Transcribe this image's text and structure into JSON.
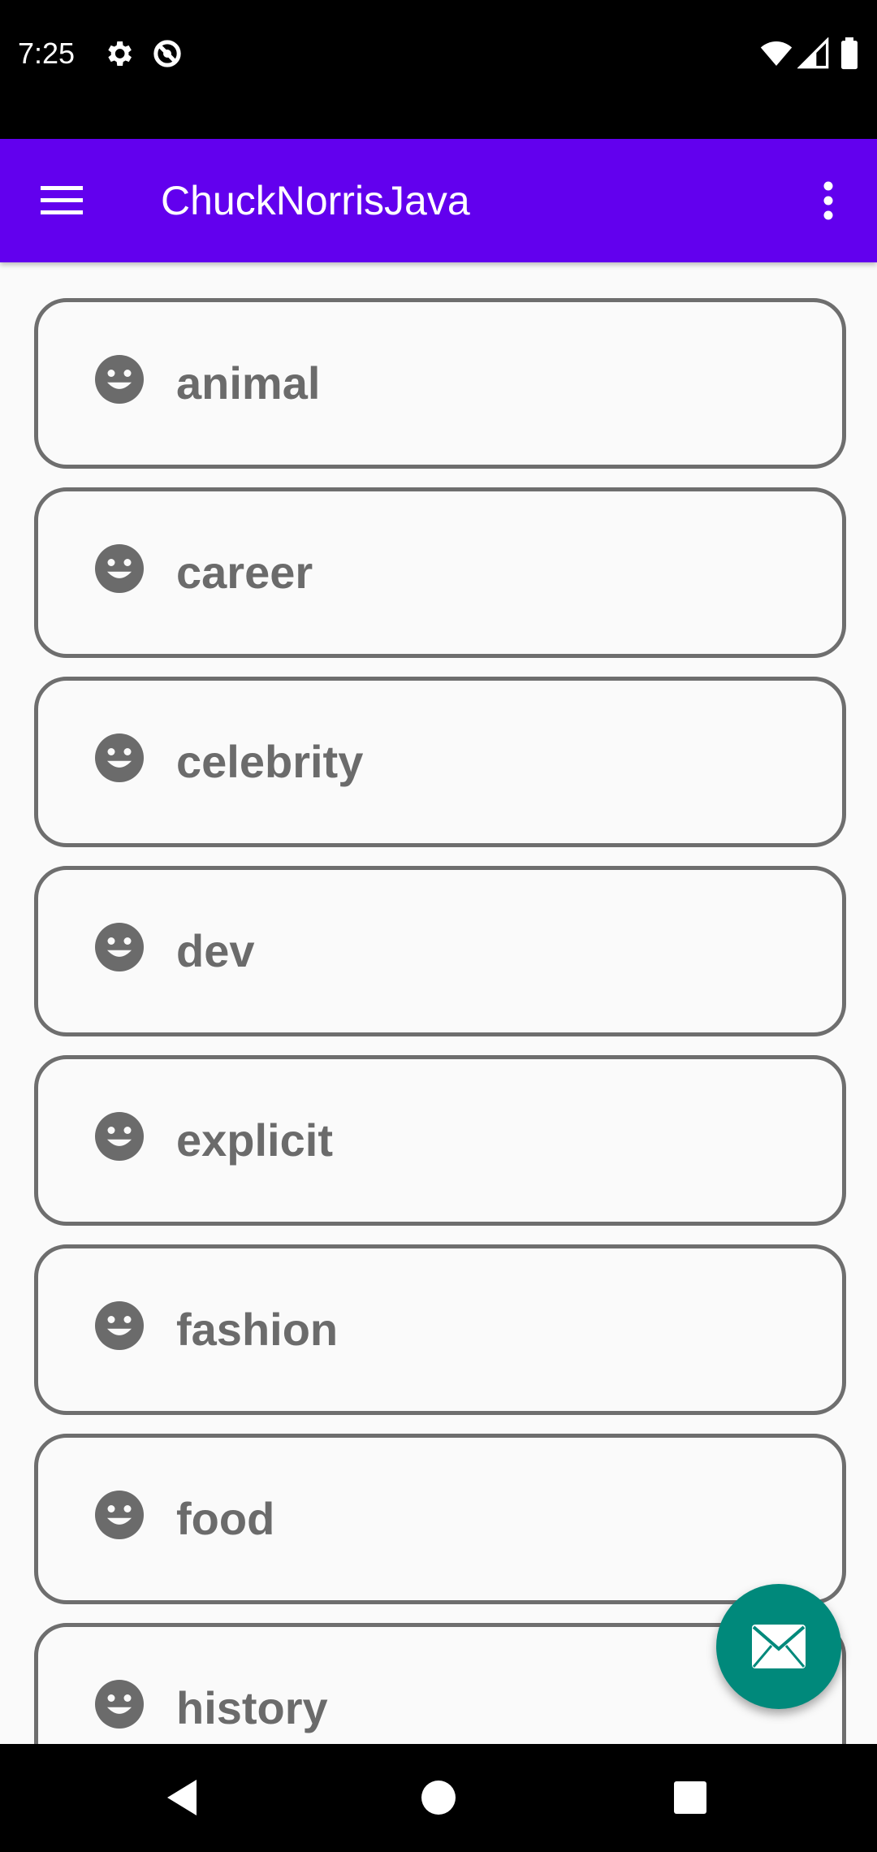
{
  "status_bar": {
    "time": "7:25",
    "left_icons": [
      "gear-icon",
      "data-saver-icon"
    ],
    "right_icons": [
      "wifi-icon",
      "cellular-icon",
      "battery-icon"
    ]
  },
  "app_bar": {
    "title": "ChuckNorrisJava",
    "background": "#6200ee",
    "nav_icon": "hamburger-menu-icon",
    "overflow_icon": "more-vert-icon"
  },
  "categories": [
    {
      "label": "animal",
      "icon": "smiley-icon"
    },
    {
      "label": "career",
      "icon": "smiley-icon"
    },
    {
      "label": "celebrity",
      "icon": "smiley-icon"
    },
    {
      "label": "dev",
      "icon": "smiley-icon"
    },
    {
      "label": "explicit",
      "icon": "smiley-icon"
    },
    {
      "label": "fashion",
      "icon": "smiley-icon"
    },
    {
      "label": "food",
      "icon": "smiley-icon"
    },
    {
      "label": "history",
      "icon": "smiley-icon"
    }
  ],
  "fab": {
    "icon": "mail-icon",
    "color": "#00897b"
  },
  "nav_bar": {
    "buttons": [
      "back-icon",
      "home-icon",
      "recents-icon"
    ]
  }
}
